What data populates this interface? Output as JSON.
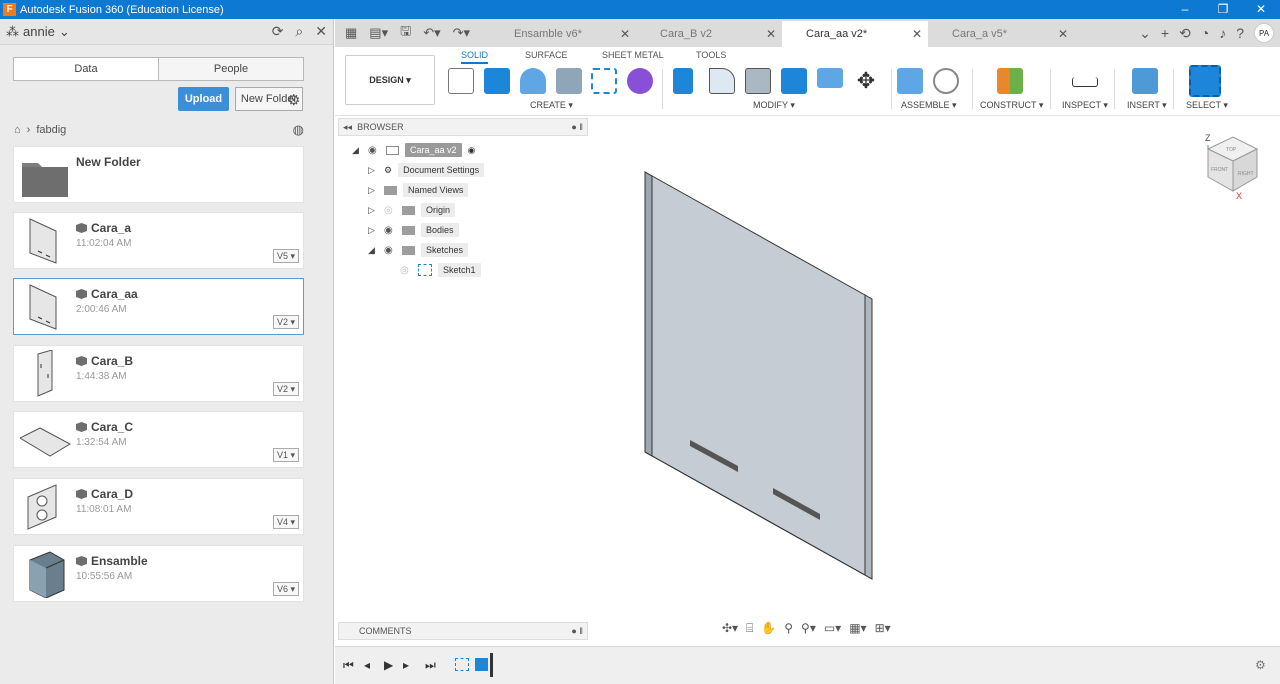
{
  "titlebar": {
    "title": "Autodesk Fusion 360 (Education License)",
    "app_icon": "F"
  },
  "left_panel": {
    "user": "annie",
    "tabs": [
      "Data",
      "People"
    ],
    "upload_label": "Upload",
    "new_folder_label": "New Folder",
    "breadcrumb": "fabdig",
    "items": [
      {
        "name": "New Folder",
        "time": "",
        "version": ""
      },
      {
        "name": "Cara_a",
        "time": "11:02:04 AM",
        "version": "V5 ▾"
      },
      {
        "name": "Cara_aa",
        "time": "2:00:46 AM",
        "version": "V2 ▾"
      },
      {
        "name": "Cara_B",
        "time": "1:44:38 AM",
        "version": "V2 ▾"
      },
      {
        "name": "Cara_C",
        "time": "1:32:54 AM",
        "version": "V1 ▾"
      },
      {
        "name": "Cara_D",
        "time": "11:08:01 AM",
        "version": "V4 ▾"
      },
      {
        "name": "Ensamble",
        "time": "10:55:56 AM",
        "version": "V6 ▾"
      }
    ]
  },
  "doc_tabs": [
    {
      "label": "Ensamble v6*"
    },
    {
      "label": "Cara_B v2"
    },
    {
      "label": "Cara_aa v2*"
    },
    {
      "label": "Cara_a v5*"
    }
  ],
  "avatar": "PA",
  "ribbon": {
    "tabs": [
      "SOLID",
      "SURFACE",
      "SHEET METAL",
      "TOOLS"
    ],
    "workspace": "DESIGN ▾",
    "groups": [
      "CREATE ▾",
      "MODIFY ▾",
      "ASSEMBLE ▾",
      "CONSTRUCT ▾",
      "INSPECT ▾",
      "INSERT ▾",
      "SELECT ▾"
    ]
  },
  "browser": {
    "title": "BROWSER",
    "root": "Cara_aa v2",
    "nodes": [
      "Document Settings",
      "Named Views",
      "Origin",
      "Bodies",
      "Sketches"
    ],
    "sketch": "Sketch1"
  },
  "comments_label": "COMMENTS",
  "viewcube": {
    "top": "TOP",
    "front": "FRONT",
    "right": "RIGHT",
    "z": "Z",
    "x": "X"
  }
}
